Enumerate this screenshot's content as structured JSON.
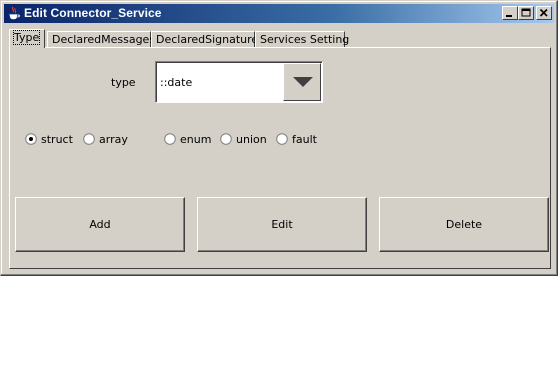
{
  "window": {
    "title": "Edit Connector_Service",
    "minimize_icon": "minimize-icon",
    "maximize_icon": "maximize-icon",
    "close_icon": "close-icon"
  },
  "tabs": [
    {
      "label": "Type",
      "active": true
    },
    {
      "label": "DeclaredMessages",
      "active": false
    },
    {
      "label": "DeclaredSignatures",
      "active": false
    },
    {
      "label": "Services Setting",
      "active": false
    }
  ],
  "form": {
    "type_label": "type",
    "type_value": "::date"
  },
  "radios": [
    {
      "label": "struct",
      "checked": true
    },
    {
      "label": "array",
      "checked": false
    },
    {
      "label": "enum",
      "checked": false
    },
    {
      "label": "union",
      "checked": false
    },
    {
      "label": "fault",
      "checked": false
    }
  ],
  "buttons": {
    "add": "Add",
    "edit": "Edit",
    "delete": "Delete"
  },
  "colors": {
    "titlebar_start": "#0a246a",
    "titlebar_end": "#a6caf0",
    "face": "#d4d0c8"
  }
}
